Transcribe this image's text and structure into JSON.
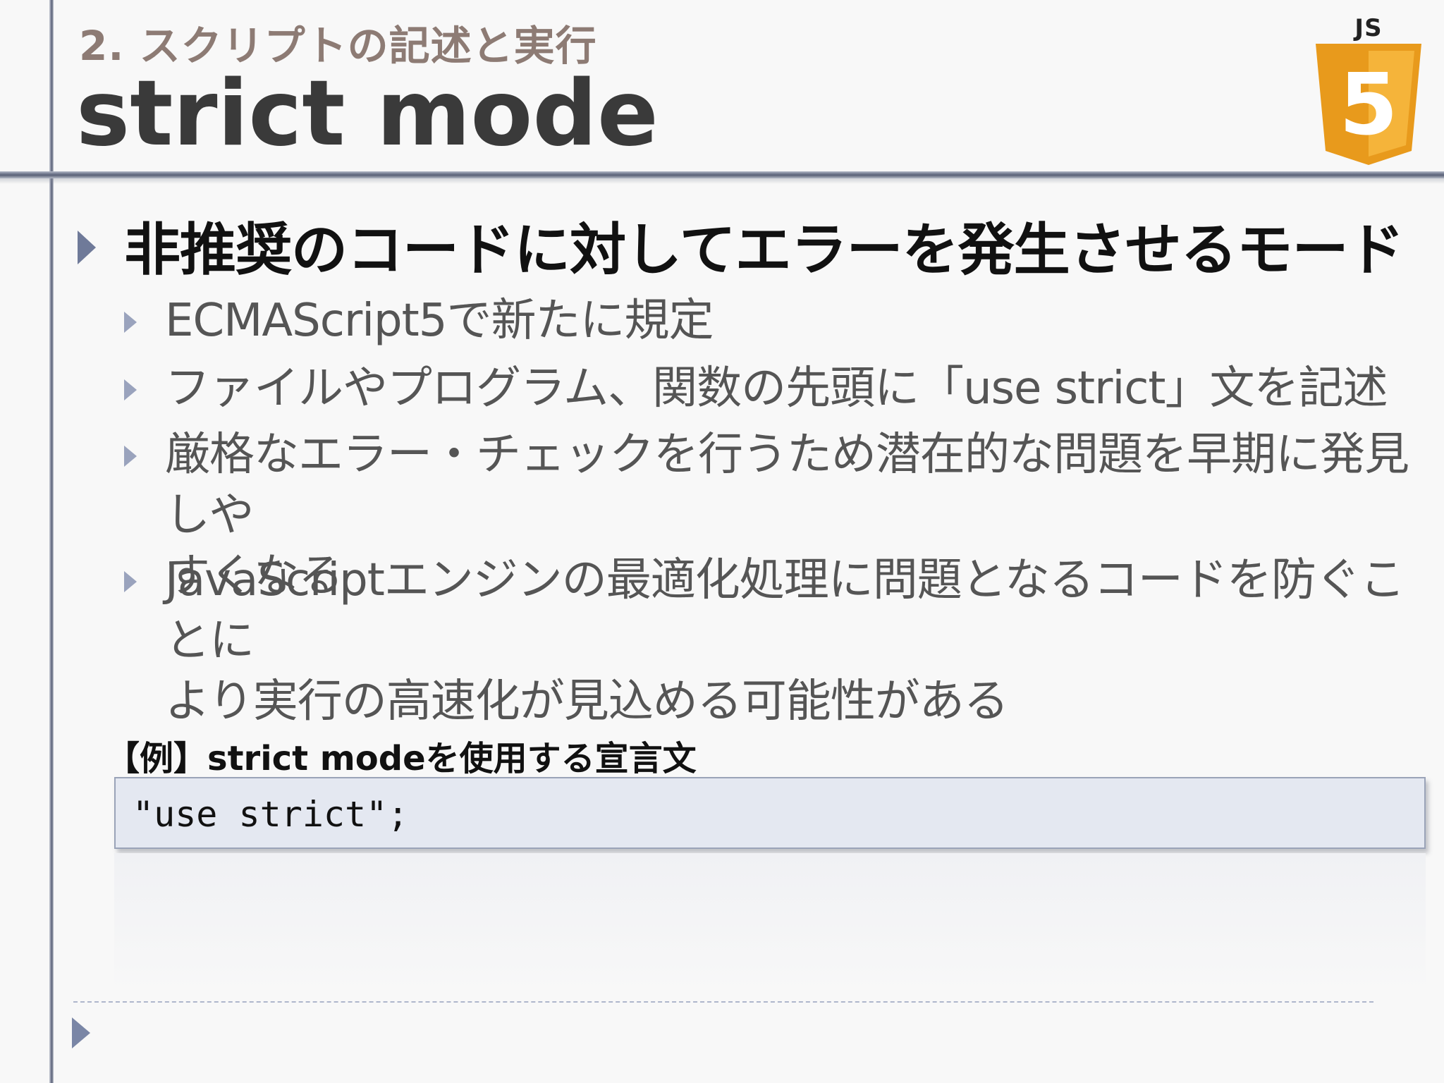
{
  "header": {
    "section_label": "2. スクリプトの記述と実行",
    "title": "strict mode",
    "logo_text": "JS",
    "logo_number": "5"
  },
  "content": {
    "main_bullet": "非推奨のコードに対してエラーを発生させるモード",
    "sub_bullets": [
      {
        "lines": [
          "ECMAScript5で新たに規定"
        ]
      },
      {
        "lines": [
          "ファイルやプログラム、関数の先頭に「use strict」文を記述"
        ]
      },
      {
        "lines": [
          "厳格なエラー・チェックを行うため潜在的な問題を早期に発見しや",
          "すくなる"
        ]
      },
      {
        "lines": [
          "JavaScriptエンジンの最適化処理に問題となるコードを防ぐことに",
          "より実行の高速化が見込める可能性がある"
        ]
      }
    ]
  },
  "example": {
    "label": "【例】strict modeを使用する宣言文",
    "code": "\"use strict\";"
  },
  "colors": {
    "section_label": "#8d7b74",
    "title": "#3a3a3a",
    "bullet_accent": "#6f7a99",
    "code_background": "#e4e8f1",
    "logo_orange": "#f0a020"
  }
}
